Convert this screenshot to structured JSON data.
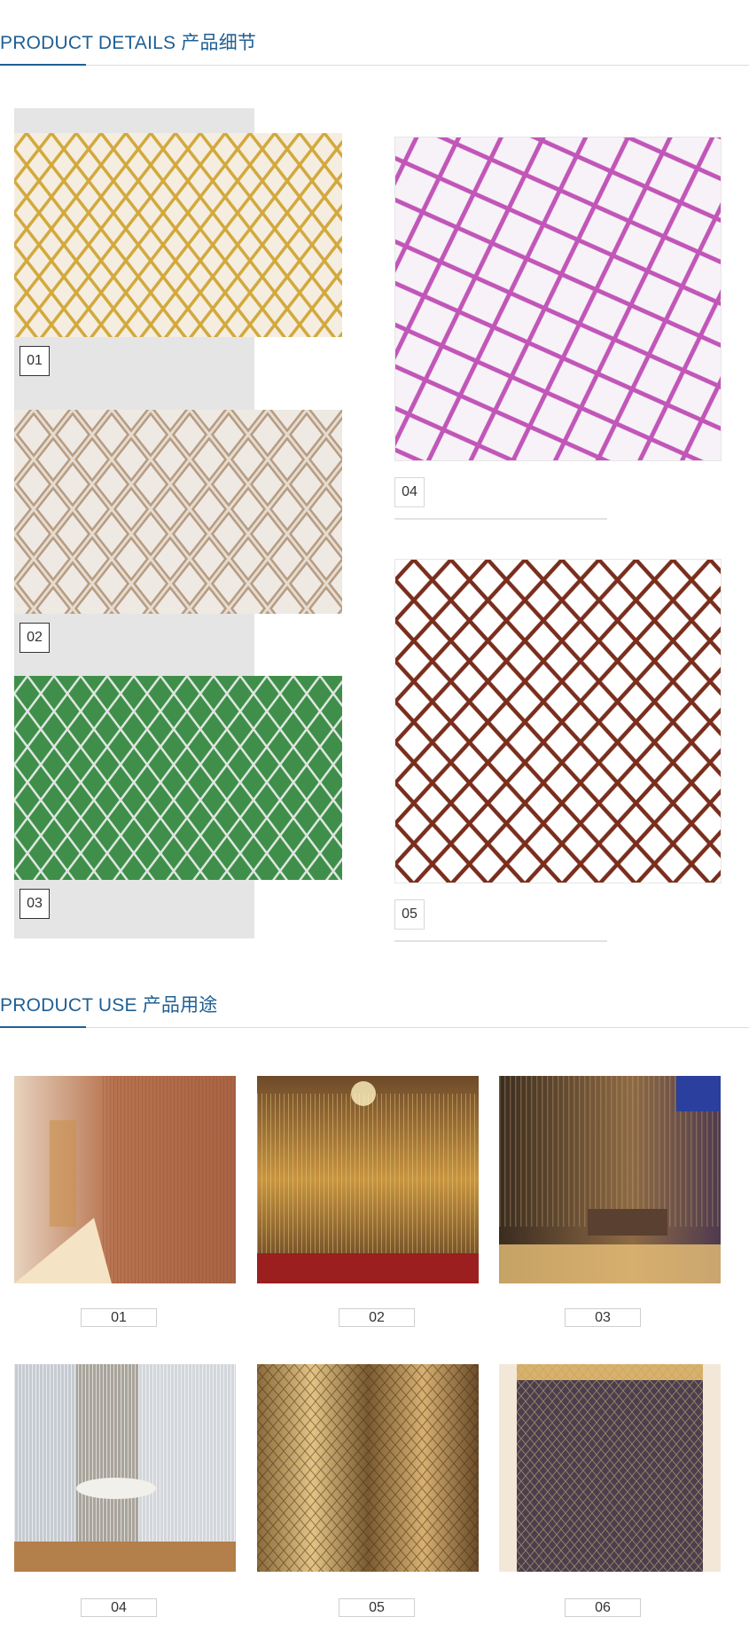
{
  "details_section": {
    "title": "PRODUCT DETAILS  产品细节",
    "items": [
      {
        "number": "01",
        "image": "gold-mesh-photo"
      },
      {
        "number": "02",
        "image": "silver-mesh-photo"
      },
      {
        "number": "03",
        "image": "green-mesh-photo"
      },
      {
        "number": "04",
        "image": "pink-mesh-photo"
      },
      {
        "number": "05",
        "image": "brown-mesh-photo"
      }
    ]
  },
  "use_section": {
    "title": "PRODUCT USE  产品用途",
    "items": [
      {
        "number": "01",
        "image": "corridor-curtain-photo"
      },
      {
        "number": "02",
        "image": "restaurant-gold-curtain-photo"
      },
      {
        "number": "03",
        "image": "dining-room-curtain-photo"
      },
      {
        "number": "04",
        "image": "silver-divider-photo"
      },
      {
        "number": "05",
        "image": "gold-drape-photo"
      },
      {
        "number": "06",
        "image": "bronze-curtain-photo"
      }
    ]
  },
  "colors": {
    "accent": "#1f5f94",
    "gold": "#d2a93c",
    "silver": "#c9b7a6",
    "green": "#3f8f4a",
    "pink": "#c156b8",
    "brown": "#7a2e1d"
  }
}
